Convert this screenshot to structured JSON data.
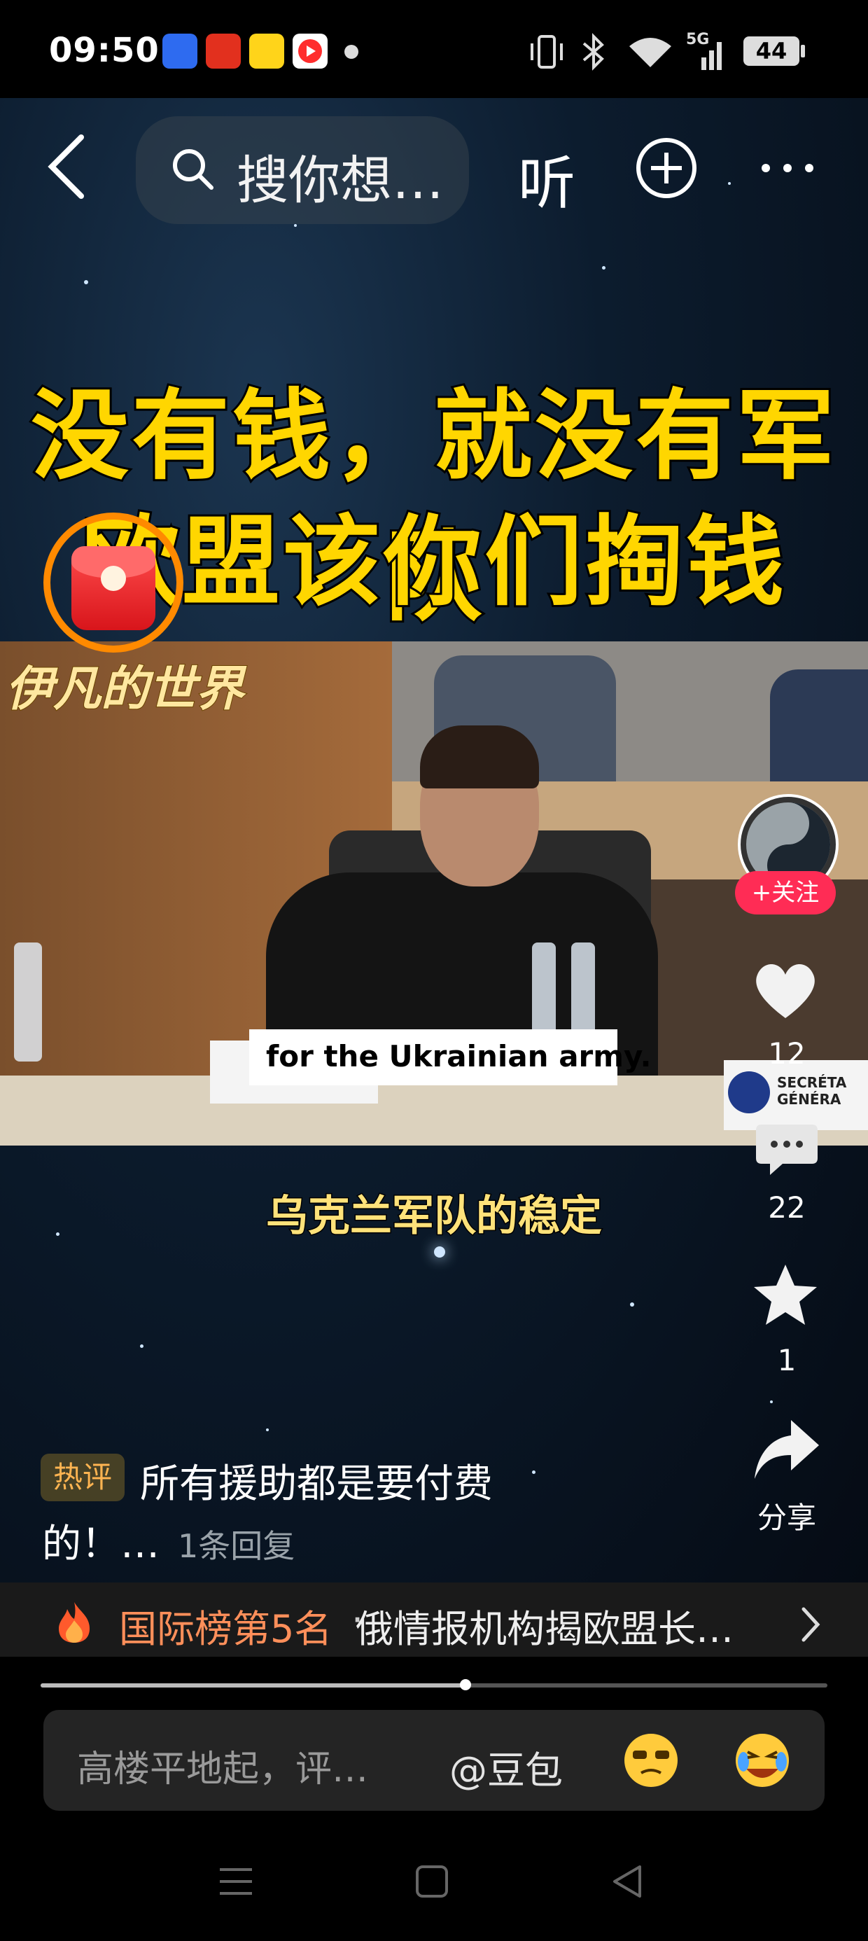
{
  "status_bar": {
    "time": "09:50",
    "battery": "44",
    "network": "5G"
  },
  "top_nav": {
    "search_placeholder": "搜你想…",
    "listen_label": "听"
  },
  "video": {
    "caption_line1": "没有钱，就没有军队",
    "caption_line2": "欧盟该你们掏钱了！",
    "channel_watermark": "伊凡的世界",
    "subtitle_en": "for the Ukrainian army.",
    "subtitle_cn": "乌克兰军队的稳定",
    "nameplate": "SECRÉTA GÉNÉRA"
  },
  "side_actions": {
    "follow_label": "+关注",
    "like_count": "12",
    "comment_count": "22",
    "favorite_count": "1",
    "share_label": "分享"
  },
  "hot_comment": {
    "badge": "热评",
    "text_line1": "所有援助都是要付费",
    "text_line2": "的！…",
    "reply_count": "1条回复"
  },
  "ranking": {
    "label": "国际榜第5名",
    "separator": "·",
    "headline": "俄情报机构揭欧盟长…"
  },
  "playback": {
    "progress": 0.54
  },
  "comment_input": {
    "placeholder": "高楼平地起，评…",
    "mention": "@豆包"
  },
  "colors": {
    "caption_yellow": "#ffd600",
    "follow_red": "#ff2c55",
    "rank_orange": "#ff8f5a"
  }
}
